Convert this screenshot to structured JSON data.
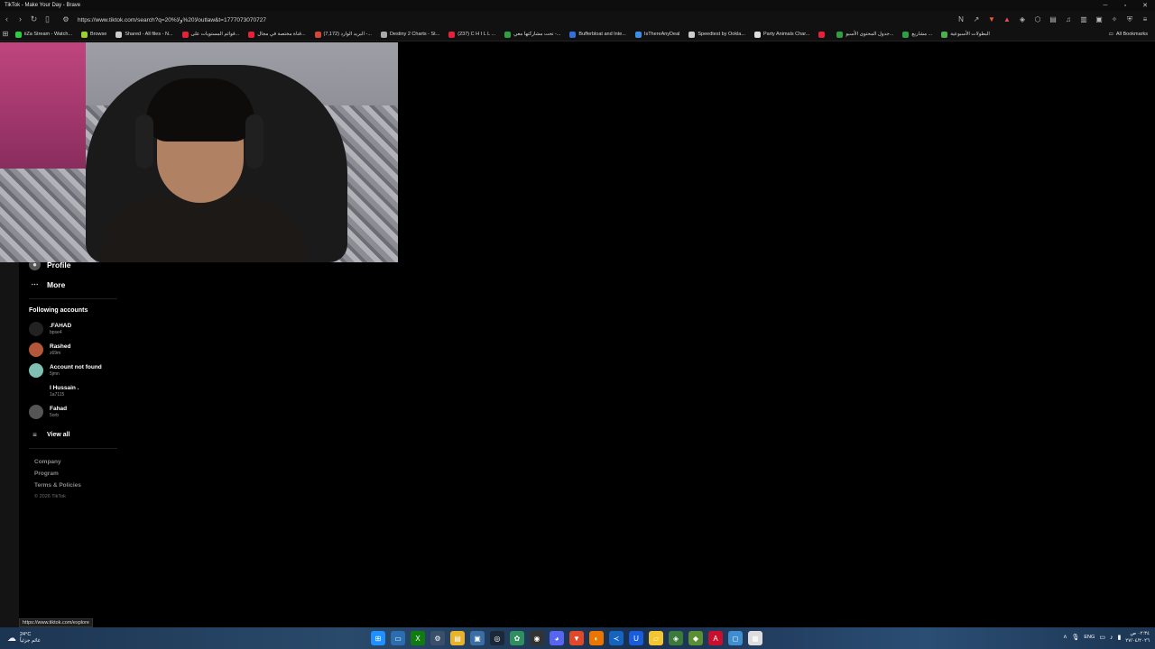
{
  "window": {
    "title": "TikTok - Make Your Day - Brave"
  },
  "toolbar": {
    "url": "https://www.tiktok.com/search?q=20%لا20%ولاoutlaw&t=1777073070727"
  },
  "bookmarks": [
    {
      "label": "iiZa Stream - Watch...",
      "color": "#2ecc40"
    },
    {
      "label": "Browse",
      "color": "#9bd12b"
    },
    {
      "label": "Shared - All files - N...",
      "color": "#cccccc"
    },
    {
      "label": "قوائم المستويات على...",
      "color": "#e6223a"
    },
    {
      "label": "قناة مختصة في مجال...",
      "color": "#e6223a"
    },
    {
      "label": "(7,172) البريد الوارد -...",
      "color": "#d44638"
    },
    {
      "label": "Destiny 2 Charts - St...",
      "color": "#aaaaaa"
    },
    {
      "label": "(237) C H I L L ...",
      "color": "#e6223a"
    },
    {
      "label": "تحت مشاركتها معي -...",
      "color": "#2ea043"
    },
    {
      "label": "Bufferbloat and Inte...",
      "color": "#2f6fdf"
    },
    {
      "label": "IsThereAnyDeal",
      "color": "#3a8fe8"
    },
    {
      "label": "Speedtest by Ookla...",
      "color": "#cccccc"
    },
    {
      "label": "Party Animals Char...",
      "color": "#dddddd"
    },
    {
      "label": "",
      "color": "#e6223a"
    },
    {
      "label": "جدول المحتوى الأسبو...",
      "color": "#2ea043"
    },
    {
      "label": "مشاريع ...",
      "color": "#2ea043"
    },
    {
      "label": "البطولات الأسبوعية",
      "color": "#4caf50"
    }
  ],
  "all_bookmarks": "All Bookmarks",
  "sidebar": {
    "nav": [
      {
        "label": "Profile",
        "icon": "avatar"
      },
      {
        "label": "More",
        "icon": "ellipsis"
      }
    ],
    "following_title": "Following accounts",
    "accounts": [
      {
        "name": ".FAHAD",
        "user": "bpse4",
        "avatar": "#222222"
      },
      {
        "name": "Rashed",
        "user": "z69m",
        "avatar": "#b3563a"
      },
      {
        "name": "Account not found",
        "user": "5jmn",
        "avatar": "#7fc0b2"
      },
      {
        "name": "I Hussain .",
        "user": "1a7115",
        "avatar": "#000000"
      },
      {
        "name": "Fahad",
        "user": "5orb",
        "avatar": "#555555"
      }
    ],
    "view_all": "View all",
    "footer": [
      "Company",
      "Program",
      "Terms & Policies"
    ],
    "copyright": "© 2026 TikTok"
  },
  "status_link": "https://www.tiktok.com/explore",
  "taskbar": {
    "temp": "24°C",
    "weather_desc": "غائم جزئياً",
    "lang": "ENG",
    "time": "٠٢:٣٤ ص",
    "date": "٢٧/٠٤/٢٠٢٦",
    "apps": [
      {
        "name": "start",
        "color": "#1e90ff",
        "glyph": "⊞"
      },
      {
        "name": "explorer-window",
        "color": "#2a6db0",
        "glyph": "▭"
      },
      {
        "name": "xbox",
        "color": "#107c10",
        "glyph": "X"
      },
      {
        "name": "settings",
        "color": "#3a4f6a",
        "glyph": "⚙"
      },
      {
        "name": "file-explorer",
        "color": "#e8b32a",
        "glyph": "▤"
      },
      {
        "name": "app-blue",
        "color": "#3a6ea5",
        "glyph": "▣"
      },
      {
        "name": "steam",
        "color": "#1b2838",
        "glyph": "◎"
      },
      {
        "name": "photos",
        "color": "#2f8f5f",
        "glyph": "✿"
      },
      {
        "name": "obs",
        "color": "#333333",
        "glyph": "◉"
      },
      {
        "name": "discord",
        "color": "#5865f2",
        "glyph": "◕"
      },
      {
        "name": "brave",
        "color": "#e0482a",
        "glyph": "▼"
      },
      {
        "name": "blender",
        "color": "#ea7600",
        "glyph": "◐"
      },
      {
        "name": "vscode",
        "color": "#1565c0",
        "glyph": "≺"
      },
      {
        "name": "bitwarden",
        "color": "#175ddc",
        "glyph": "U"
      },
      {
        "name": "sticky-notes",
        "color": "#f2c62e",
        "glyph": "▱"
      },
      {
        "name": "app-green",
        "color": "#3b7a3b",
        "glyph": "◈"
      },
      {
        "name": "minecraft",
        "color": "#5a8f32",
        "glyph": "◆"
      },
      {
        "name": "acrobat",
        "color": "#c8102e",
        "glyph": "A"
      },
      {
        "name": "app-sky",
        "color": "#3e8ed0",
        "glyph": "◻"
      },
      {
        "name": "calendar",
        "color": "#dddddd",
        "glyph": "▦"
      }
    ]
  }
}
